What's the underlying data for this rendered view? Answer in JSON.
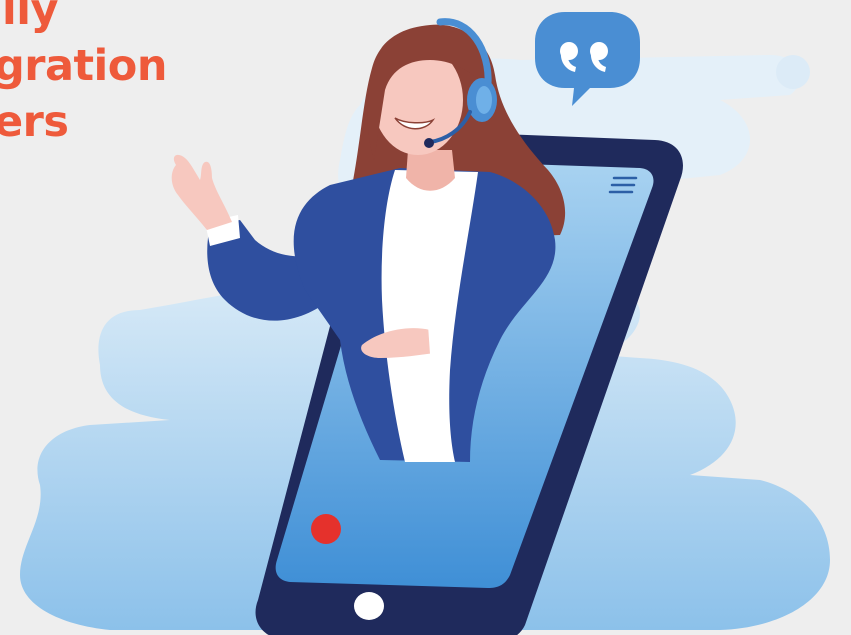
{
  "headline": {
    "line1": "lly",
    "line2": "gration",
    "line3": "ers"
  },
  "colors": {
    "background": "#eeeeee",
    "headline_text": "#ee5a3b",
    "cloud_light": "#e3f0f9",
    "cloud_blue": "#b8d9f1",
    "phone_frame": "#1f2a5c",
    "phone_screen": "#5ba3dd",
    "jacket": "#2f4f9f",
    "shirt": "#ffffff",
    "hair": "#8b4136",
    "skin": "#f7c8bf",
    "headset": "#4a8ed3",
    "record_button": "#e5312c",
    "quote_bubble": "#4a8ed3"
  },
  "icons": {
    "quote_bubble": "quote-bubble-icon",
    "menu_lines": "menu-lines-icon",
    "record_button": "record-dot-icon",
    "home_button": "home-button-icon"
  }
}
